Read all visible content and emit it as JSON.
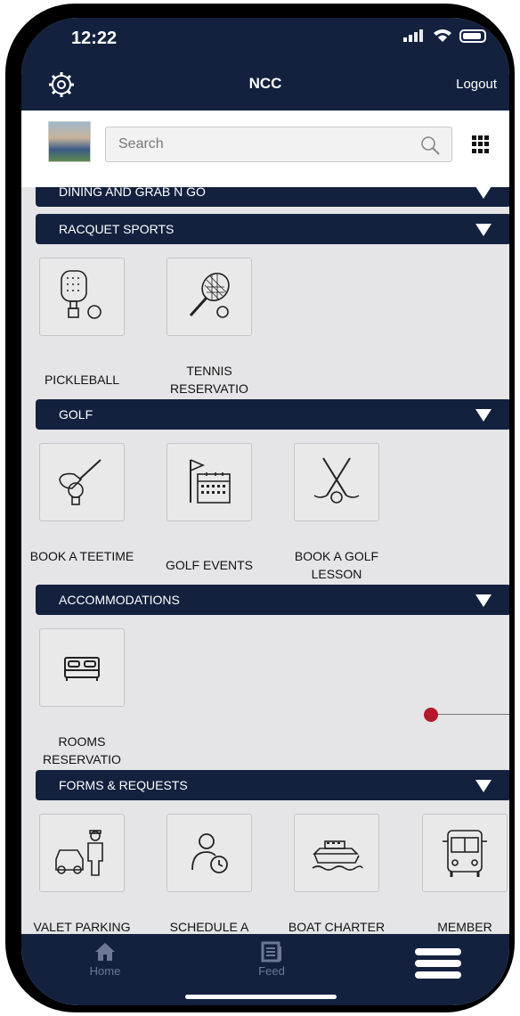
{
  "status": {
    "time": "12:22"
  },
  "header": {
    "title": "NCC",
    "logout_label": "Logout"
  },
  "search": {
    "placeholder": "Search"
  },
  "sections": [
    {
      "label": "DINING AND GRAB N GO"
    },
    {
      "label": "RACQUET SPORTS",
      "items": [
        {
          "label": "PICKLEBALL",
          "icon": "pickleball-paddle-icon"
        },
        {
          "label": "TENNIS RESERVATIO",
          "icon": "tennis-racket-icon"
        }
      ]
    },
    {
      "label": "GOLF",
      "items": [
        {
          "label": "BOOK A TEETIME",
          "icon": "golf-club-ball-icon"
        },
        {
          "label": "GOLF EVENTS",
          "icon": "golf-flag-calendar-icon"
        },
        {
          "label": "BOOK A GOLF LESSON",
          "icon": "crossed-golf-clubs-icon"
        }
      ]
    },
    {
      "label": "ACCOMMODATIONS",
      "items": [
        {
          "label": "ROOMS RESERVATIO",
          "icon": "bed-icon"
        }
      ]
    },
    {
      "label": "FORMS & REQUESTS",
      "items": [
        {
          "label": "VALET PARKING",
          "icon": "valet-car-icon"
        },
        {
          "label": "SCHEDULE A VISITOR",
          "icon": "visitor-clock-icon"
        },
        {
          "label": "BOAT CHARTER",
          "icon": "boat-icon"
        },
        {
          "label": "MEMBER TRANSPORT",
          "icon": "bus-icon"
        }
      ]
    }
  ],
  "tabbar": {
    "home_label": "Home",
    "feed_label": "Feed"
  },
  "colors": {
    "navy": "#13213f",
    "background": "#e5e5e7",
    "accent_red": "#b3192b"
  }
}
